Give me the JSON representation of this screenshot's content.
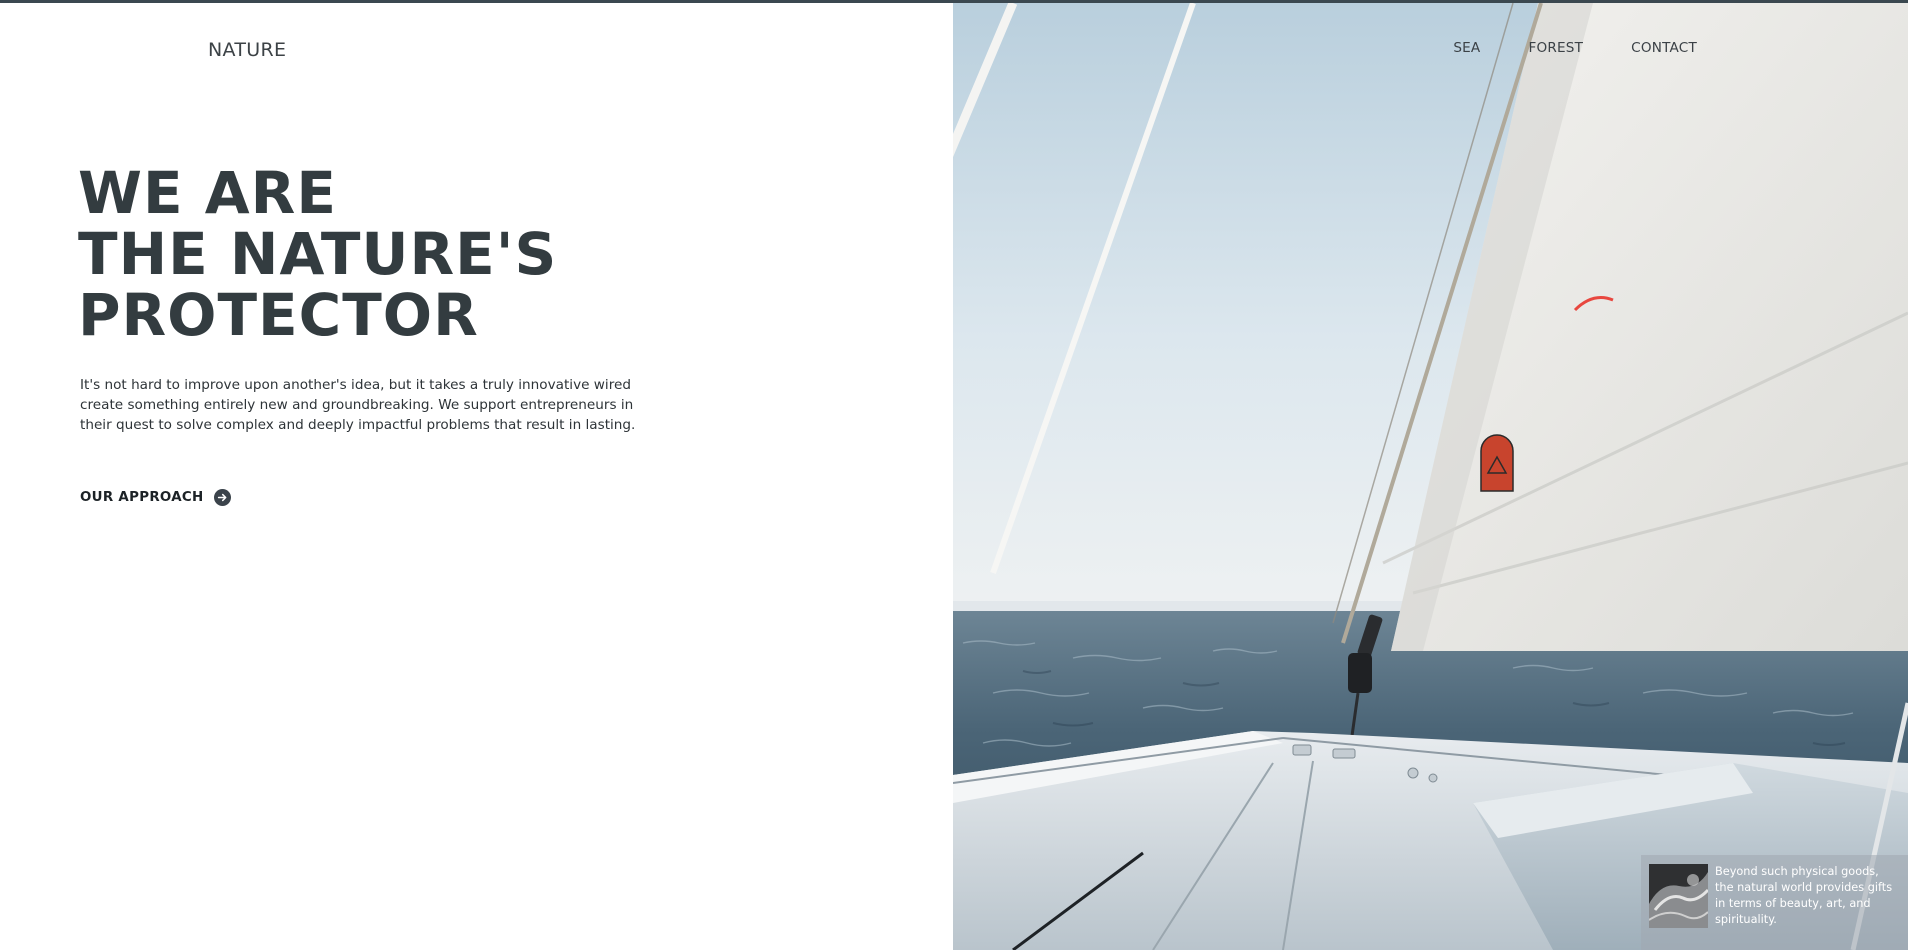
{
  "brand": {
    "logo_text": "NATURE"
  },
  "nav": {
    "items": [
      {
        "label": "SEA"
      },
      {
        "label": "FOREST"
      },
      {
        "label": "CONTACT"
      }
    ]
  },
  "hero": {
    "headline_lines": [
      "WE ARE",
      "THE NATURE'S",
      "PROTECTOR"
    ],
    "intro": "It's not hard to improve upon another's idea, but it takes a truly innovative wired create something entirely new and groundbreaking. We support entrepreneurs in their quest to solve complex and deeply impactful problems that result in lasting.",
    "cta_label": "OUR APPROACH",
    "cta_icon": "arrow-right-circle-icon"
  },
  "card": {
    "text": "Beyond such physical goods, the natural world provides gifts in terms of beauty, art, and spirituality."
  },
  "colors": {
    "accent_dark": "#333c40",
    "top_strip": "#3b4850",
    "sky": "#cfdde6",
    "sea": "#4d6779",
    "sail": "#ebeae6"
  }
}
